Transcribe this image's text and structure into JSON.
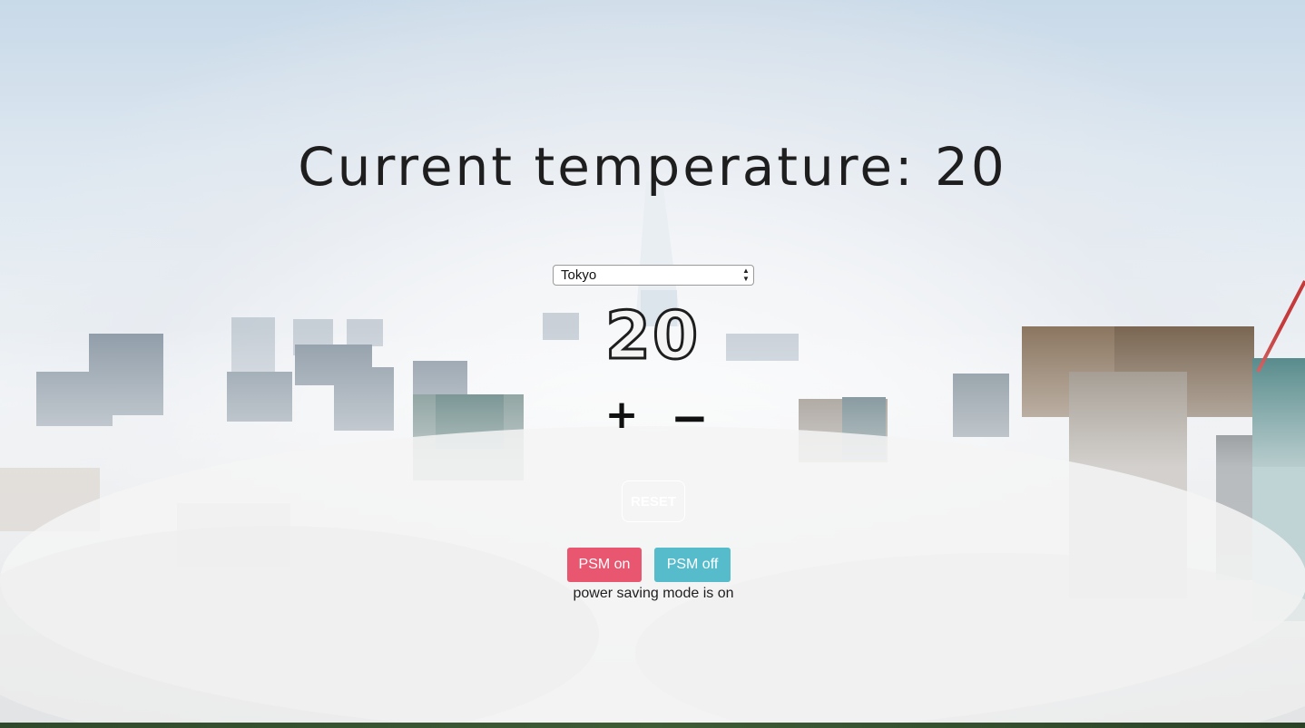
{
  "header": {
    "title": "Current temperature: 20"
  },
  "city_select": {
    "selected": "Tokyo",
    "options": [
      "Tokyo"
    ]
  },
  "thermostat": {
    "temperature_display": "20",
    "increase_label": "+",
    "decrease_label": "−",
    "reset_label": "RESET"
  },
  "power_saving": {
    "on_label": "PSM on",
    "off_label": "PSM off",
    "status_text": "power saving mode is on"
  },
  "colors": {
    "psm_on": "#e8566f",
    "psm_off": "#56bccb",
    "text": "#1e1e1e"
  }
}
